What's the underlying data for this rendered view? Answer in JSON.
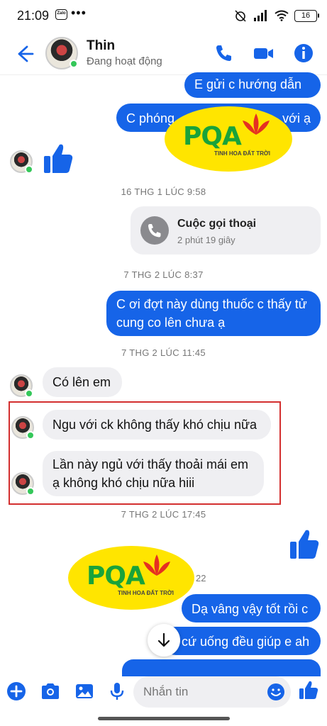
{
  "status_bar": {
    "time": "21:09",
    "zalo": "Zalo",
    "dots": "•••",
    "battery": "16"
  },
  "header": {
    "name": "Thin",
    "status": "Đang hoạt động"
  },
  "messages": {
    "m1": "E gửi c hướng dẫn ạ",
    "m2a": "C phóng",
    "m2b": "với ạ",
    "ts1": "16 THG 1 LÚC 9:58",
    "call_title": "Cuộc gọi thoại",
    "call_sub": "2 phút 19 giây",
    "ts2": "7 THG 2 LÚC 8:37",
    "m3": "C ơi đợt này dùng thuốc c thấy tử cung co lên chưa ạ",
    "ts3": "7 THG 2 LÚC 11:45",
    "m4": "Có lên em",
    "m5": "Ngu với ck không thấy khó chịu nữa",
    "m6": "Lần này ngủ với thấy thoải mái em ạ không khó chịu nữa hiii",
    "ts4": "7 THG 2 LÚC 17:45",
    "partial_ts": "22",
    "m7": "Dạ vâng vậy tốt rồi c",
    "m8": "cứ uống đều giúp e ah"
  },
  "watermark": {
    "brand": "PQA",
    "tagline": "TINH HOA ĐẤT TRỜI"
  },
  "composer": {
    "placeholder": "Nhắn tin"
  },
  "colors": {
    "messenger_blue": "#1664e8",
    "bubble_gray": "#efeff2",
    "highlight_red": "#d32f2f",
    "brand_yellow": "#ffe500",
    "brand_green": "#19a33a"
  }
}
